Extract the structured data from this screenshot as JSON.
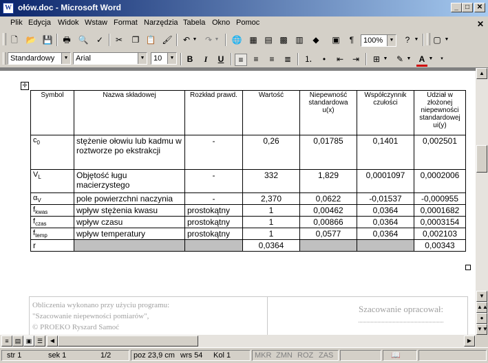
{
  "window": {
    "title": "ołów.doc - Microsoft Word",
    "app_icon_letter": "W"
  },
  "menu": [
    "Plik",
    "Edycja",
    "Widok",
    "Wstaw",
    "Format",
    "Narzędzia",
    "Tabela",
    "Okno",
    "Pomoc"
  ],
  "toolbar": {
    "zoom": "100%"
  },
  "formatting": {
    "style": "Standardowy",
    "font": "Arial",
    "size": "10",
    "bold": "B",
    "italic": "I",
    "underline": "U"
  },
  "table": {
    "headers": [
      "Symbol",
      "Nazwa składowej",
      "Rozkład prawd.",
      "Wartość",
      "Niepewność standardowa u(x)",
      "Współczynnik czułości",
      "Udział w złożonej niepewności standardowej ui(y)"
    ],
    "rows": [
      {
        "sym_main": "c",
        "sym_sub": "0",
        "name": "stężenie ołowiu lub kadmu w roztworze po ekstrakcji",
        "dist": "-",
        "value": "0,26",
        "u": "0,01785",
        "c": "0,1401",
        "contrib": "0,002501"
      },
      {
        "sym_main": "V",
        "sym_sub": "L",
        "name": "Objętość ługu macierzystego",
        "dist": "-",
        "value": "332",
        "u": "1,829",
        "c": "0,0001097",
        "contrib": "0,0002006"
      },
      {
        "sym_main": "α",
        "sym_sub": "V",
        "name": "pole powierzchni naczynia",
        "dist": "-",
        "value": "2,370",
        "u": "0,0622",
        "c": "-0,01537",
        "contrib": "-0,000955"
      },
      {
        "sym_main": "f",
        "sym_sub": "kwas",
        "name": "wpływ stężenia kwasu",
        "dist": "prostokątny",
        "value": "1",
        "u": "0,00462",
        "c": "0,0364",
        "contrib": "0,0001682"
      },
      {
        "sym_main": "f",
        "sym_sub": "czas",
        "name": "wpływ czasu",
        "dist": "prostokątny",
        "value": "1",
        "u": "0,00866",
        "c": "0,0364",
        "contrib": "0,0003154"
      },
      {
        "sym_main": "f",
        "sym_sub": "temp",
        "name": "wpływ temperatury",
        "dist": "prostokątny",
        "value": "1",
        "u": "0,0577",
        "c": "0,0364",
        "contrib": "0,002103"
      }
    ],
    "result": {
      "sym": "r",
      "value": "0,0364",
      "contrib": "0,00343"
    }
  },
  "footer": {
    "line1": "Obliczenia wykonano przy użyciu programu:",
    "line2": "\"Szacowanie niepewności pomiarów\",",
    "line3": "©  PROEKO Ryszard Samoć",
    "right": "Szacowanie opracował:"
  },
  "status": {
    "page": "str  1",
    "section": "sek  1",
    "pages": "1/2",
    "pos": "poz  23,9 cm",
    "line": "wrs  54",
    "col": "Kol  1",
    "rec": "MKR",
    "trk": "ZMN",
    "ext": "ROZ",
    "ovr": "ZAS"
  }
}
